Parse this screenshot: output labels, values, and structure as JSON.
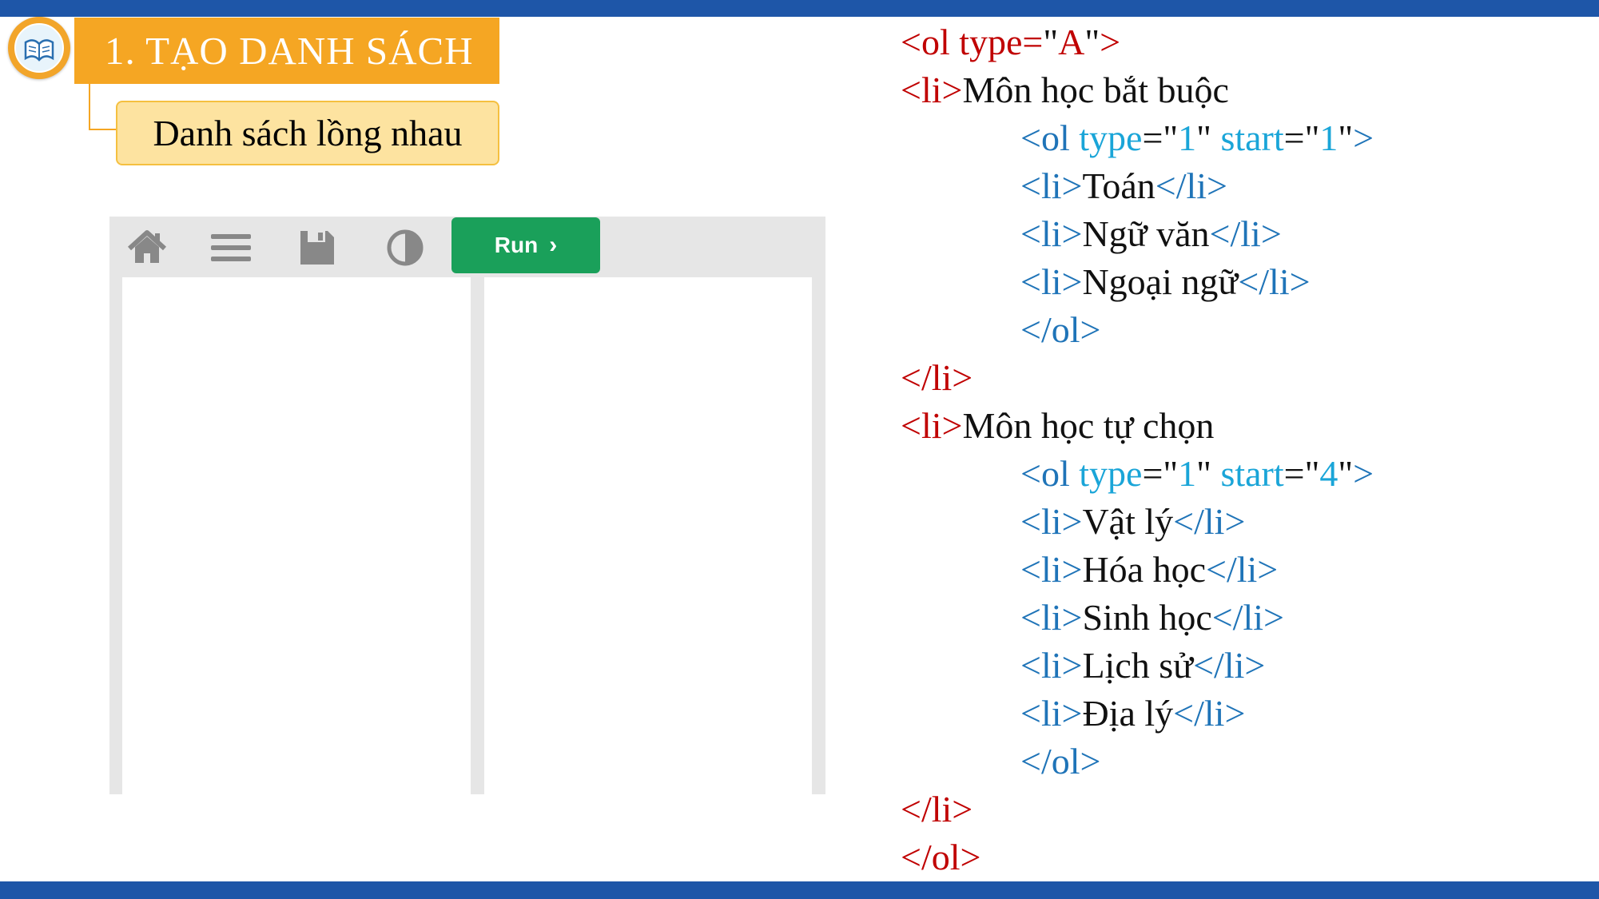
{
  "section_title": "1. TẠO DANH SÁCH",
  "sub_title": "Danh sách lồng nhau",
  "editor": {
    "run_label": "Run",
    "icons": [
      "home-icon",
      "menu-icon",
      "save-icon",
      "contrast-icon",
      "chevron-right-icon"
    ]
  },
  "colors": {
    "top_bar": "#1e56a8",
    "title_bg": "#f5a623",
    "subtitle_bg": "#fde3a0",
    "run_button": "#1aa05a",
    "code_outer_tag": "#c00000",
    "code_inner_tag": "#1f74b8",
    "code_attr_value": "#1aa5d8"
  },
  "code": {
    "l1": {
      "open": "<ol type=",
      "q1": "\"",
      "value": "A",
      "q2": "\"",
      "close": ">"
    },
    "l2": {
      "tag": "<li>",
      "text": "Môn học bắt buộc"
    },
    "l3": {
      "open": "<ol",
      "attr1": " type",
      "eq1": "=\"",
      "val1": "1",
      "eq1b": "\" ",
      "attr2": "start",
      "eq2": "=\"",
      "val2": "1",
      "eq2b": "\"",
      "close": ">"
    },
    "l4": {
      "open": "<li>",
      "text": "Toán",
      "close": "</li>"
    },
    "l5": {
      "open": "<li>",
      "text": "Ngữ văn",
      "close": "</li>"
    },
    "l6": {
      "open": "<li>",
      "text": "Ngoại ngữ",
      "close": "</li>"
    },
    "l7": {
      "tag": "</ol>"
    },
    "l8": {
      "tag": "</li>"
    },
    "l9": {
      "tag": "<li>",
      "text": "Môn học tự chọn"
    },
    "l10": {
      "open": "<ol",
      "attr1": " type",
      "eq1": "=\"",
      "val1": "1",
      "eq1b": "\" ",
      "attr2": "start",
      "eq2": "=\"",
      "val2": "4",
      "eq2b": "\"",
      "close": ">"
    },
    "l11": {
      "open": "<li>",
      "text": "Vật lý",
      "close": "</li>"
    },
    "l12": {
      "open": "<li>",
      "text": "Hóa học",
      "close": "</li>"
    },
    "l13": {
      "open": "<li>",
      "text": "Sinh học",
      "close": "</li>"
    },
    "l14": {
      "open": "<li>",
      "text": "Lịch sử",
      "close": "</li>"
    },
    "l15": {
      "open": "<li>",
      "text": "Địa lý",
      "close": "</li>"
    },
    "l16": {
      "tag": "</ol>"
    },
    "l17": {
      "tag": "</li>"
    },
    "l18": {
      "tag": "</ol>"
    }
  }
}
